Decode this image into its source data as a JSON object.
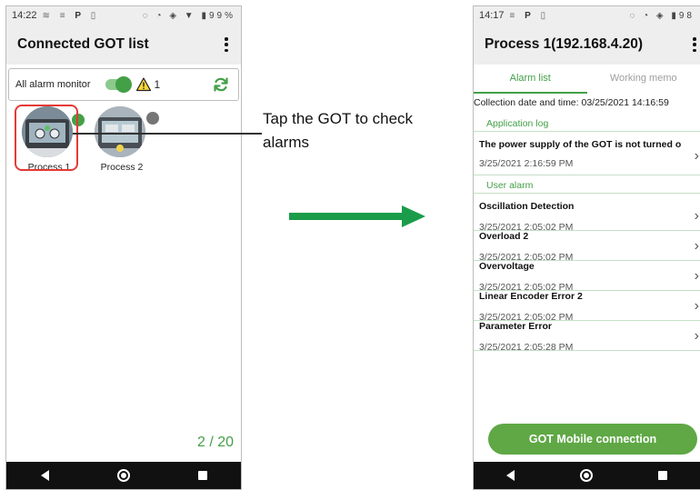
{
  "left_phone": {
    "status": {
      "time": "14:22",
      "battery": "99%"
    },
    "title": "Connected GOT list",
    "alarm_monitor": {
      "label": "All alarm monitor",
      "toggle_on": true,
      "alarm_count": "1"
    },
    "gots": [
      {
        "name": "Process 1",
        "status_color": "#43a047"
      },
      {
        "name": "Process 2",
        "status_color": "#757575"
      }
    ],
    "page_count": "2 / 20"
  },
  "annotation": {
    "text": "Tap the GOT to check alarms"
  },
  "right_phone": {
    "status": {
      "time": "14:17",
      "battery": "98"
    },
    "title": "Process 1(192.168.4.20)",
    "tabs": [
      {
        "label": "Alarm list",
        "active": true
      },
      {
        "label": "Working memo",
        "active": false
      }
    ],
    "collection": "Collection date and time: 03/25/2021 14:16:59",
    "app_log": {
      "heading": "Application log",
      "items": [
        {
          "title": "The power supply of the GOT is not turned on, o…",
          "date": "3/25/2021 2:16:59 PM"
        }
      ]
    },
    "user_alarm": {
      "heading": "User alarm",
      "items": [
        {
          "title": "Oscillation Detection",
          "date": "3/25/2021 2:05:02 PM"
        },
        {
          "title": "Overload 2",
          "date": "3/25/2021 2:05:02 PM"
        },
        {
          "title": "Overvoltage",
          "date": "3/25/2021 2:05:02 PM"
        },
        {
          "title": "Linear Encoder Error 2",
          "date": "3/25/2021 2:05:02 PM"
        },
        {
          "title": "Parameter Error",
          "date": "3/25/2021 2:05:28 PM"
        }
      ]
    },
    "connect_button": "GOT Mobile connection"
  },
  "colors": {
    "accent_green": "#43a047",
    "button_green": "#5fa845",
    "highlight_red": "#e53935"
  },
  "icons": [
    "more-vert-icon",
    "warning-icon",
    "refresh-icon",
    "chevron-right-icon",
    "nav-back-icon",
    "nav-home-icon",
    "nav-recent-icon"
  ]
}
